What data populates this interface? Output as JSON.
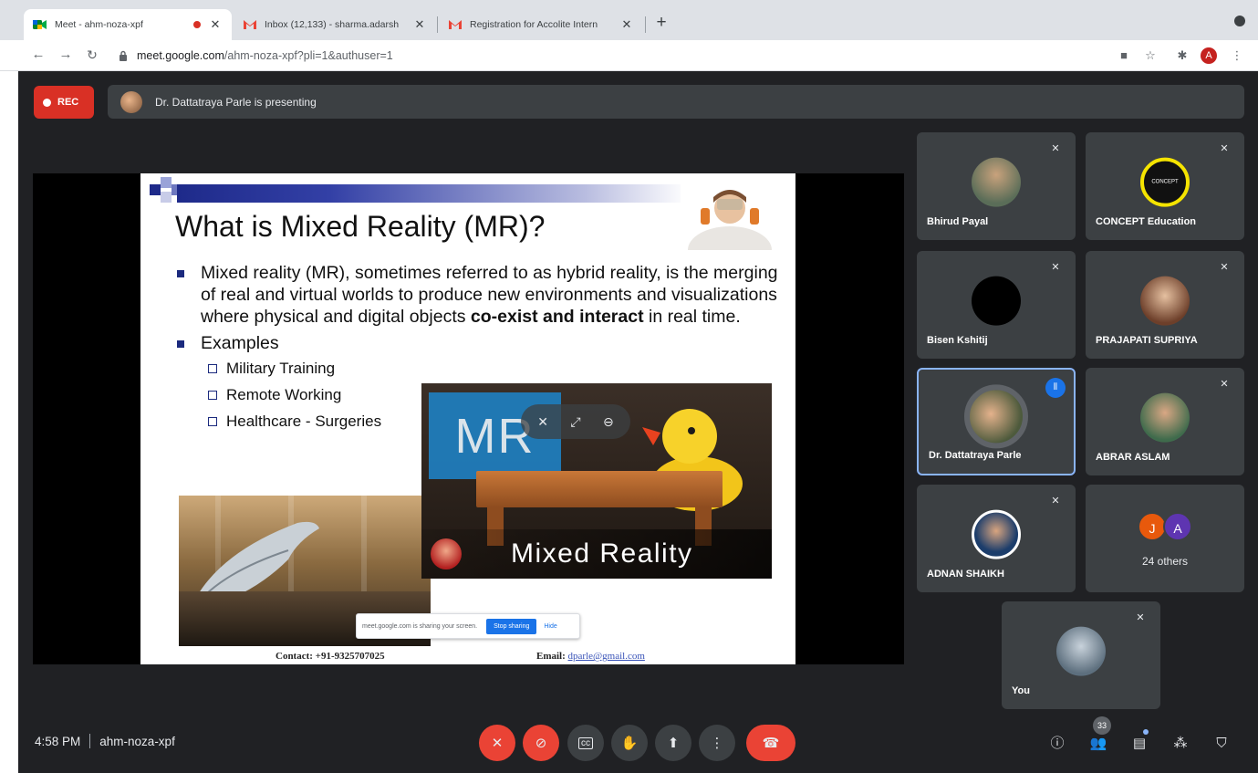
{
  "browser": {
    "tabs": [
      {
        "title": "Meet - ahm-noza-xpf",
        "favicon": "google-meet-icon",
        "recording": true
      },
      {
        "title": "Inbox (12,133) - sharma.adarsh",
        "favicon": "gmail-icon"
      },
      {
        "title": "Registration for Accolite Intern",
        "favicon": "gmail-icon"
      }
    ],
    "new_tab": "+",
    "url_host": "meet.google.com",
    "url_path": "/ahm-noza-xpf?pli=1&authuser=1",
    "profile_initial": "A"
  },
  "meet": {
    "rec_label": "REC",
    "presenting_text": "Dr. Dattatraya Parle is presenting",
    "time": "4:58 PM",
    "meeting_code": "ahm-noza-xpf",
    "participant_count": "33",
    "accent_color": "#1a73e8",
    "danger_color": "#ea4335"
  },
  "slide": {
    "title": "What is Mixed Reality (MR)?",
    "bullet1_a": "Mixed reality (MR), sometimes referred to as hybrid reality, is the merging of real and virtual worlds to produce new environments and visualizations where physical and digital objects ",
    "bullet1_b": "co-exist and interact",
    "bullet1_c": " in real time.",
    "bullet2": "Examples",
    "examples": [
      "Military Training",
      "Remote Working",
      "Healthcare - Surgeries"
    ],
    "mr_logo": "MR",
    "mr_caption": "Mixed Reality",
    "contact": "Contact: +91-9325707025",
    "email_label": "Email:",
    "email": "dparle@gmail.com",
    "share_pill": {
      "text": "meet.google.com is sharing your screen.",
      "stop": "Stop sharing",
      "hide": "Hide"
    }
  },
  "participants": [
    {
      "name": "Bhirud Payal"
    },
    {
      "name": "CONCEPT Education",
      "avatar_text": "CONCEPT"
    },
    {
      "name": "Bisen Kshitij"
    },
    {
      "name": "PRAJAPATI SUPRIYA"
    },
    {
      "name": "Dr. Dattatraya Parle"
    },
    {
      "name": "ABRAR ASLAM"
    },
    {
      "name": "ADNAN SHAIKH"
    },
    {
      "name": "You"
    }
  ],
  "others": {
    "initials": [
      "J",
      "A"
    ],
    "colors": [
      "#e8590c",
      "#5e35b1"
    ],
    "label": "24 others"
  }
}
